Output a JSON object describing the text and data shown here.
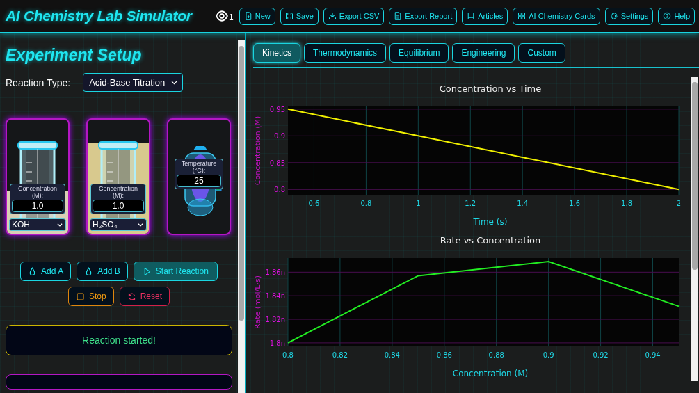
{
  "header": {
    "title": "AI Chemistry Lab Simulator",
    "viewer_count": "1",
    "buttons": [
      {
        "kind": "new",
        "label": "New"
      },
      {
        "kind": "save",
        "label": "Save"
      },
      {
        "kind": "export",
        "label": "Export CSV"
      },
      {
        "kind": "report",
        "label": "Export Report"
      },
      {
        "kind": "articles",
        "label": "Articles"
      },
      {
        "kind": "cards",
        "label": "AI Chemistry Cards"
      },
      {
        "kind": "settings",
        "label": "Settings"
      },
      {
        "kind": "help",
        "label": "Help"
      }
    ]
  },
  "setup": {
    "heading": "Experiment Setup",
    "reaction_type": {
      "label": "Reaction Type:",
      "value": "Acid-Base Titration"
    },
    "vessels": [
      {
        "kind": "beaker",
        "level": 0.38,
        "color": "#d9ceb5",
        "concentration_label": "Concentration (M):",
        "concentration": "1.0",
        "reagent": "KOH"
      },
      {
        "kind": "beaker",
        "level": 0.8,
        "color": "#d8c98e",
        "concentration_label": "Concentration (M):",
        "concentration": "1.0",
        "reagent": "H₂SO₄"
      },
      {
        "kind": "reactor",
        "temperature_label": "Temperature (°C):",
        "temperature": "25"
      }
    ],
    "actions": [
      [
        {
          "kind": "drop",
          "label": "Add A"
        },
        {
          "kind": "drop",
          "label": "Add B"
        },
        {
          "kind": "start",
          "label": "Start Reaction"
        }
      ],
      [
        {
          "kind": "stop",
          "label": "Stop"
        },
        {
          "kind": "reset",
          "label": "Reset"
        }
      ]
    ],
    "status": "Reaction started!"
  },
  "tabs": [
    {
      "label": "Kinetics",
      "selected": true
    },
    {
      "label": "Thermodynamics",
      "selected": false
    },
    {
      "label": "Equilibrium",
      "selected": false
    },
    {
      "label": "Engineering",
      "selected": false
    },
    {
      "label": "Custom",
      "selected": false
    }
  ],
  "charts": [
    {
      "chart_data": {
        "type": "line",
        "title": "Concentration vs Time",
        "xlabel": "Time (s)",
        "ylabel": "Concentration (M)",
        "x": [
          0.5,
          1,
          1.5,
          2
        ],
        "series": [
          {
            "color": "#f0f000",
            "values": [
              0.95,
              0.9,
              0.85,
              0.8
            ]
          }
        ],
        "grid": true,
        "xlim": [
          0.5,
          2
        ],
        "ylim": [
          0.79,
          0.955
        ],
        "xticks": [
          0.6,
          0.8,
          1,
          1.2,
          1.4,
          1.6,
          1.8,
          2
        ],
        "yticks": [
          0.8,
          0.85,
          0.9,
          0.95
        ]
      }
    },
    {
      "chart_data": {
        "type": "line",
        "title": "Rate vs Concentration",
        "xlabel": "Concentration (M)",
        "ylabel": "Rate (mol/L·s)",
        "x": [
          0.8,
          0.85,
          0.9,
          0.95
        ],
        "series": [
          {
            "color": "#22ee22",
            "values": [
              1.8,
              1.857,
              1.869,
              1.831
            ]
          }
        ],
        "grid": true,
        "xlim": [
          0.8,
          0.95
        ],
        "ylim": [
          1.797,
          1.872
        ],
        "xticks": [
          0.8,
          0.82,
          0.84,
          0.86,
          0.88,
          0.9,
          0.92,
          0.94
        ],
        "yticks": [
          {
            "value": 1.8,
            "label": "1.8n"
          },
          {
            "value": 1.82,
            "label": "1.82n"
          },
          {
            "value": 1.84,
            "label": "1.84n"
          },
          {
            "value": 1.86,
            "label": "1.86n"
          }
        ]
      }
    }
  ]
}
